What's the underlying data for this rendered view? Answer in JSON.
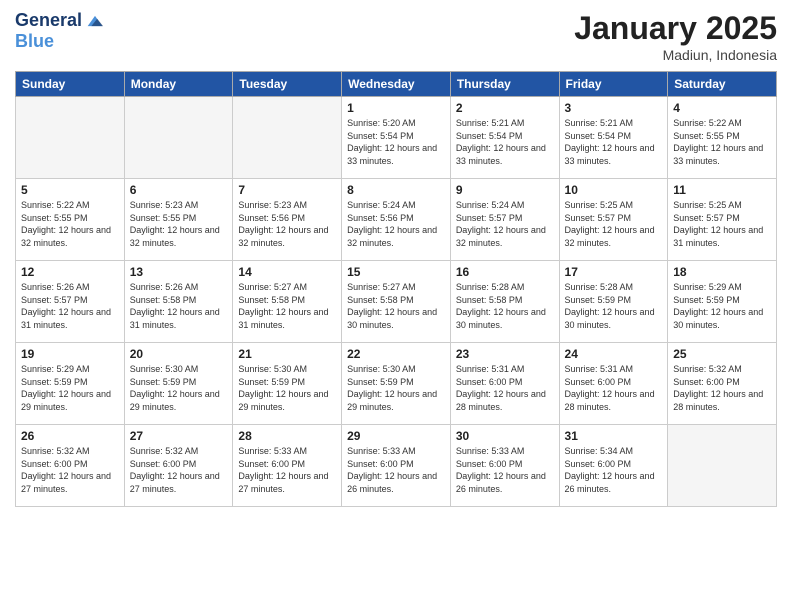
{
  "header": {
    "logo_line1": "General",
    "logo_line2": "Blue",
    "month_title": "January 2025",
    "location": "Madiun, Indonesia"
  },
  "days_of_week": [
    "Sunday",
    "Monday",
    "Tuesday",
    "Wednesday",
    "Thursday",
    "Friday",
    "Saturday"
  ],
  "weeks": [
    [
      {
        "day": "",
        "sunrise": "",
        "sunset": "",
        "daylight": ""
      },
      {
        "day": "",
        "sunrise": "",
        "sunset": "",
        "daylight": ""
      },
      {
        "day": "",
        "sunrise": "",
        "sunset": "",
        "daylight": ""
      },
      {
        "day": "1",
        "sunrise": "Sunrise: 5:20 AM",
        "sunset": "Sunset: 5:54 PM",
        "daylight": "Daylight: 12 hours and 33 minutes."
      },
      {
        "day": "2",
        "sunrise": "Sunrise: 5:21 AM",
        "sunset": "Sunset: 5:54 PM",
        "daylight": "Daylight: 12 hours and 33 minutes."
      },
      {
        "day": "3",
        "sunrise": "Sunrise: 5:21 AM",
        "sunset": "Sunset: 5:54 PM",
        "daylight": "Daylight: 12 hours and 33 minutes."
      },
      {
        "day": "4",
        "sunrise": "Sunrise: 5:22 AM",
        "sunset": "Sunset: 5:55 PM",
        "daylight": "Daylight: 12 hours and 33 minutes."
      }
    ],
    [
      {
        "day": "5",
        "sunrise": "Sunrise: 5:22 AM",
        "sunset": "Sunset: 5:55 PM",
        "daylight": "Daylight: 12 hours and 32 minutes."
      },
      {
        "day": "6",
        "sunrise": "Sunrise: 5:23 AM",
        "sunset": "Sunset: 5:55 PM",
        "daylight": "Daylight: 12 hours and 32 minutes."
      },
      {
        "day": "7",
        "sunrise": "Sunrise: 5:23 AM",
        "sunset": "Sunset: 5:56 PM",
        "daylight": "Daylight: 12 hours and 32 minutes."
      },
      {
        "day": "8",
        "sunrise": "Sunrise: 5:24 AM",
        "sunset": "Sunset: 5:56 PM",
        "daylight": "Daylight: 12 hours and 32 minutes."
      },
      {
        "day": "9",
        "sunrise": "Sunrise: 5:24 AM",
        "sunset": "Sunset: 5:57 PM",
        "daylight": "Daylight: 12 hours and 32 minutes."
      },
      {
        "day": "10",
        "sunrise": "Sunrise: 5:25 AM",
        "sunset": "Sunset: 5:57 PM",
        "daylight": "Daylight: 12 hours and 32 minutes."
      },
      {
        "day": "11",
        "sunrise": "Sunrise: 5:25 AM",
        "sunset": "Sunset: 5:57 PM",
        "daylight": "Daylight: 12 hours and 31 minutes."
      }
    ],
    [
      {
        "day": "12",
        "sunrise": "Sunrise: 5:26 AM",
        "sunset": "Sunset: 5:57 PM",
        "daylight": "Daylight: 12 hours and 31 minutes."
      },
      {
        "day": "13",
        "sunrise": "Sunrise: 5:26 AM",
        "sunset": "Sunset: 5:58 PM",
        "daylight": "Daylight: 12 hours and 31 minutes."
      },
      {
        "day": "14",
        "sunrise": "Sunrise: 5:27 AM",
        "sunset": "Sunset: 5:58 PM",
        "daylight": "Daylight: 12 hours and 31 minutes."
      },
      {
        "day": "15",
        "sunrise": "Sunrise: 5:27 AM",
        "sunset": "Sunset: 5:58 PM",
        "daylight": "Daylight: 12 hours and 30 minutes."
      },
      {
        "day": "16",
        "sunrise": "Sunrise: 5:28 AM",
        "sunset": "Sunset: 5:58 PM",
        "daylight": "Daylight: 12 hours and 30 minutes."
      },
      {
        "day": "17",
        "sunrise": "Sunrise: 5:28 AM",
        "sunset": "Sunset: 5:59 PM",
        "daylight": "Daylight: 12 hours and 30 minutes."
      },
      {
        "day": "18",
        "sunrise": "Sunrise: 5:29 AM",
        "sunset": "Sunset: 5:59 PM",
        "daylight": "Daylight: 12 hours and 30 minutes."
      }
    ],
    [
      {
        "day": "19",
        "sunrise": "Sunrise: 5:29 AM",
        "sunset": "Sunset: 5:59 PM",
        "daylight": "Daylight: 12 hours and 29 minutes."
      },
      {
        "day": "20",
        "sunrise": "Sunrise: 5:30 AM",
        "sunset": "Sunset: 5:59 PM",
        "daylight": "Daylight: 12 hours and 29 minutes."
      },
      {
        "day": "21",
        "sunrise": "Sunrise: 5:30 AM",
        "sunset": "Sunset: 5:59 PM",
        "daylight": "Daylight: 12 hours and 29 minutes."
      },
      {
        "day": "22",
        "sunrise": "Sunrise: 5:30 AM",
        "sunset": "Sunset: 5:59 PM",
        "daylight": "Daylight: 12 hours and 29 minutes."
      },
      {
        "day": "23",
        "sunrise": "Sunrise: 5:31 AM",
        "sunset": "Sunset: 6:00 PM",
        "daylight": "Daylight: 12 hours and 28 minutes."
      },
      {
        "day": "24",
        "sunrise": "Sunrise: 5:31 AM",
        "sunset": "Sunset: 6:00 PM",
        "daylight": "Daylight: 12 hours and 28 minutes."
      },
      {
        "day": "25",
        "sunrise": "Sunrise: 5:32 AM",
        "sunset": "Sunset: 6:00 PM",
        "daylight": "Daylight: 12 hours and 28 minutes."
      }
    ],
    [
      {
        "day": "26",
        "sunrise": "Sunrise: 5:32 AM",
        "sunset": "Sunset: 6:00 PM",
        "daylight": "Daylight: 12 hours and 27 minutes."
      },
      {
        "day": "27",
        "sunrise": "Sunrise: 5:32 AM",
        "sunset": "Sunset: 6:00 PM",
        "daylight": "Daylight: 12 hours and 27 minutes."
      },
      {
        "day": "28",
        "sunrise": "Sunrise: 5:33 AM",
        "sunset": "Sunset: 6:00 PM",
        "daylight": "Daylight: 12 hours and 27 minutes."
      },
      {
        "day": "29",
        "sunrise": "Sunrise: 5:33 AM",
        "sunset": "Sunset: 6:00 PM",
        "daylight": "Daylight: 12 hours and 26 minutes."
      },
      {
        "day": "30",
        "sunrise": "Sunrise: 5:33 AM",
        "sunset": "Sunset: 6:00 PM",
        "daylight": "Daylight: 12 hours and 26 minutes."
      },
      {
        "day": "31",
        "sunrise": "Sunrise: 5:34 AM",
        "sunset": "Sunset: 6:00 PM",
        "daylight": "Daylight: 12 hours and 26 minutes."
      },
      {
        "day": "",
        "sunrise": "",
        "sunset": "",
        "daylight": ""
      }
    ]
  ]
}
